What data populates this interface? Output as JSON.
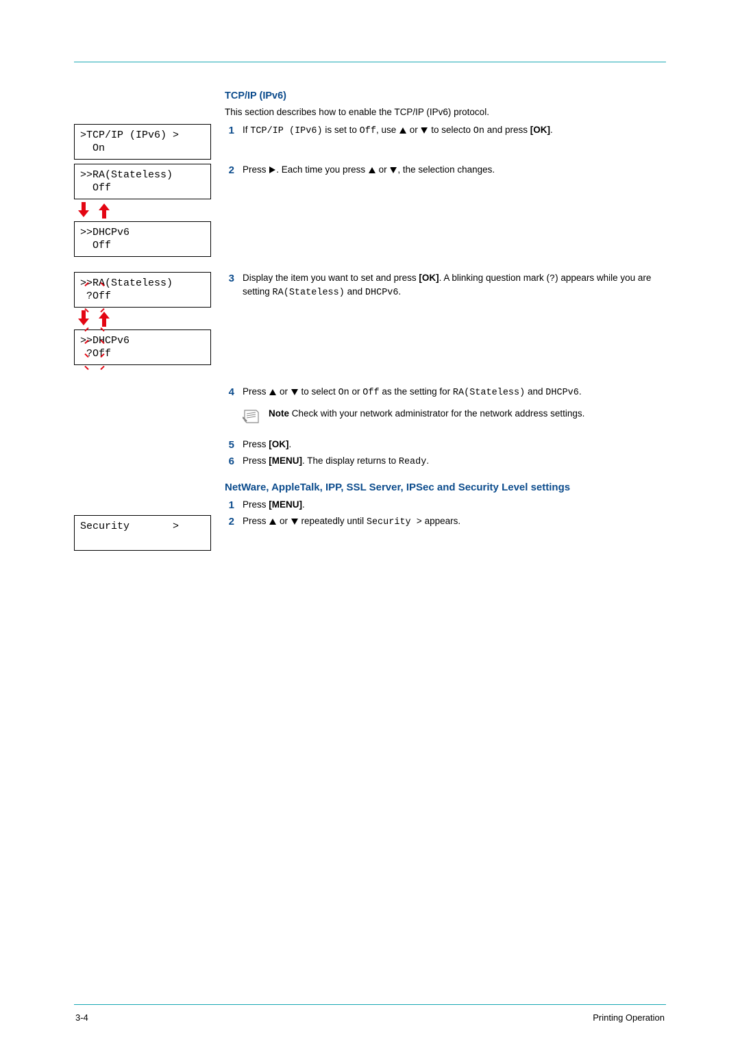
{
  "section1": {
    "title": "TCP/IP (IPv6)",
    "intro": "This section describes how to enable the TCP/IP (IPv6) protocol."
  },
  "lcds": {
    "lcd1_line1": ">TCP/IP (IPv6) >",
    "lcd1_line2": "  On",
    "lcd2_line1": ">>RA(Stateless)",
    "lcd2_line2": "  Off",
    "lcd3_line1": ">>DHCPv6",
    "lcd3_line2": "  Off",
    "lcd4_line1": ">>RA(Stateless)",
    "lcd4_line2": " ?Off",
    "lcd5_line1": ">>DHCPv6",
    "lcd5_line2": " ?Off",
    "lcd6_line1": "Security       >",
    "lcd6_line2": ""
  },
  "steps": {
    "s1_a": "If ",
    "s1_mono1": "TCP/IP (IPv6)",
    "s1_b": " is set to ",
    "s1_mono2": "Off",
    "s1_c": ", use ",
    "s1_d": " or ",
    "s1_e": " to selecto ",
    "s1_mono3": "On",
    "s1_f": " and press ",
    "s1_ok": "[OK]",
    "s1_g": ".",
    "s2_a": "Press ",
    "s2_b": ". Each time you press ",
    "s2_c": " or ",
    "s2_d": ", the selection changes.",
    "s3_a": "Display the item you want to set and press ",
    "s3_ok": "[OK]",
    "s3_b": ". A blinking question mark (",
    "s3_mono1": "?",
    "s3_c": ") appears while you are setting ",
    "s3_mono2": "RA(Stateless)",
    "s3_d": " and ",
    "s3_mono3": "DHCPv6",
    "s3_e": ".",
    "s4_a": "Press ",
    "s4_b": " or ",
    "s4_c": " to select ",
    "s4_mono1": "On",
    "s4_d": " or ",
    "s4_mono2": "Off",
    "s4_e": " as the setting for ",
    "s4_mono3": "RA(Stateless)",
    "s4_f": " and ",
    "s4_mono4": "DHCPv6",
    "s4_g": ".",
    "note_label": "Note",
    "note_text": "  Check with your network administrator for the network address settings.",
    "s5_a": "Press ",
    "s5_ok": "[OK]",
    "s5_b": ".",
    "s6_a": "Press ",
    "s6_menu": "[MENU]",
    "s6_b": ". The display returns to ",
    "s6_mono": "Ready",
    "s6_c": "."
  },
  "section2": {
    "title": "NetWare, AppleTalk, IPP, SSL Server, IPSec and Security Level settings",
    "s1_a": "Press ",
    "s1_menu": "[MENU]",
    "s1_b": ".",
    "s2_a": "Press ",
    "s2_b": " or ",
    "s2_c": " repeatedly until ",
    "s2_mono": "Security >",
    "s2_d": " appears."
  },
  "nums": {
    "n1": "1",
    "n2": "2",
    "n3": "3",
    "n4": "4",
    "n5": "5",
    "n6": "6"
  },
  "footer": {
    "left": "3-4",
    "right": "Printing Operation"
  }
}
